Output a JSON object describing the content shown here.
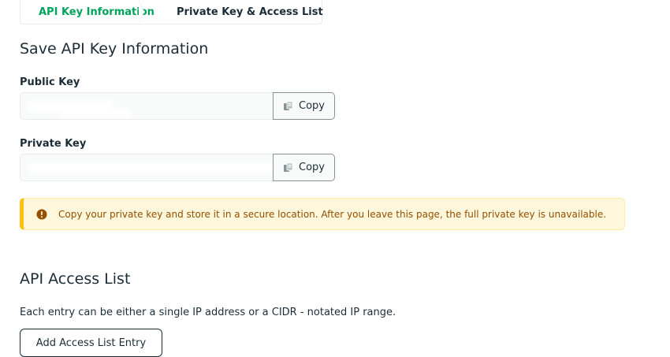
{
  "stepper": {
    "steps": [
      {
        "label": "API Key Information",
        "status": "complete",
        "icon": "check-icon"
      },
      {
        "label": "Private Key & Access List",
        "status": "current"
      }
    ],
    "complete_color": "#00a35c"
  },
  "save_section": {
    "title": "Save API Key Information",
    "public_key": {
      "label": "Public Key",
      "value": "",
      "copy_label": "Copy",
      "copy_icon": "copy-icon"
    },
    "private_key": {
      "label": "Private Key",
      "value": "",
      "copy_label": "Copy",
      "copy_icon": "copy-icon"
    }
  },
  "warning": {
    "icon": "warning-circle-icon",
    "text": "Copy your private key and store it in a secure location. After you leave this page, the full private key is unavailable.",
    "accent_color": "#ffc010",
    "text_color": "#944f01",
    "background": "#fef7db"
  },
  "access_section": {
    "title": "API Access List",
    "description": "Each entry can be either a single IP address or a CIDR - notated IP range.",
    "add_button_label": "Add Access List Entry"
  }
}
